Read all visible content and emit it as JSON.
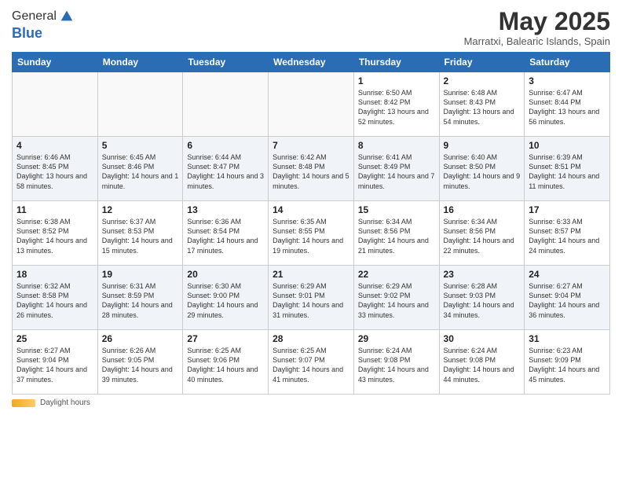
{
  "header": {
    "logo_line1": "General",
    "logo_line2": "Blue",
    "month_title": "May 2025",
    "location": "Marratxi, Balearic Islands, Spain"
  },
  "days_of_week": [
    "Sunday",
    "Monday",
    "Tuesday",
    "Wednesday",
    "Thursday",
    "Friday",
    "Saturday"
  ],
  "weeks": [
    [
      {
        "day": "",
        "info": ""
      },
      {
        "day": "",
        "info": ""
      },
      {
        "day": "",
        "info": ""
      },
      {
        "day": "",
        "info": ""
      },
      {
        "day": "1",
        "info": "Sunrise: 6:50 AM\nSunset: 8:42 PM\nDaylight: 13 hours\nand 52 minutes."
      },
      {
        "day": "2",
        "info": "Sunrise: 6:48 AM\nSunset: 8:43 PM\nDaylight: 13 hours\nand 54 minutes."
      },
      {
        "day": "3",
        "info": "Sunrise: 6:47 AM\nSunset: 8:44 PM\nDaylight: 13 hours\nand 56 minutes."
      }
    ],
    [
      {
        "day": "4",
        "info": "Sunrise: 6:46 AM\nSunset: 8:45 PM\nDaylight: 13 hours\nand 58 minutes."
      },
      {
        "day": "5",
        "info": "Sunrise: 6:45 AM\nSunset: 8:46 PM\nDaylight: 14 hours\nand 1 minute."
      },
      {
        "day": "6",
        "info": "Sunrise: 6:44 AM\nSunset: 8:47 PM\nDaylight: 14 hours\nand 3 minutes."
      },
      {
        "day": "7",
        "info": "Sunrise: 6:42 AM\nSunset: 8:48 PM\nDaylight: 14 hours\nand 5 minutes."
      },
      {
        "day": "8",
        "info": "Sunrise: 6:41 AM\nSunset: 8:49 PM\nDaylight: 14 hours\nand 7 minutes."
      },
      {
        "day": "9",
        "info": "Sunrise: 6:40 AM\nSunset: 8:50 PM\nDaylight: 14 hours\nand 9 minutes."
      },
      {
        "day": "10",
        "info": "Sunrise: 6:39 AM\nSunset: 8:51 PM\nDaylight: 14 hours\nand 11 minutes."
      }
    ],
    [
      {
        "day": "11",
        "info": "Sunrise: 6:38 AM\nSunset: 8:52 PM\nDaylight: 14 hours\nand 13 minutes."
      },
      {
        "day": "12",
        "info": "Sunrise: 6:37 AM\nSunset: 8:53 PM\nDaylight: 14 hours\nand 15 minutes."
      },
      {
        "day": "13",
        "info": "Sunrise: 6:36 AM\nSunset: 8:54 PM\nDaylight: 14 hours\nand 17 minutes."
      },
      {
        "day": "14",
        "info": "Sunrise: 6:35 AM\nSunset: 8:55 PM\nDaylight: 14 hours\nand 19 minutes."
      },
      {
        "day": "15",
        "info": "Sunrise: 6:34 AM\nSunset: 8:56 PM\nDaylight: 14 hours\nand 21 minutes."
      },
      {
        "day": "16",
        "info": "Sunrise: 6:34 AM\nSunset: 8:56 PM\nDaylight: 14 hours\nand 22 minutes."
      },
      {
        "day": "17",
        "info": "Sunrise: 6:33 AM\nSunset: 8:57 PM\nDaylight: 14 hours\nand 24 minutes."
      }
    ],
    [
      {
        "day": "18",
        "info": "Sunrise: 6:32 AM\nSunset: 8:58 PM\nDaylight: 14 hours\nand 26 minutes."
      },
      {
        "day": "19",
        "info": "Sunrise: 6:31 AM\nSunset: 8:59 PM\nDaylight: 14 hours\nand 28 minutes."
      },
      {
        "day": "20",
        "info": "Sunrise: 6:30 AM\nSunset: 9:00 PM\nDaylight: 14 hours\nand 29 minutes."
      },
      {
        "day": "21",
        "info": "Sunrise: 6:29 AM\nSunset: 9:01 PM\nDaylight: 14 hours\nand 31 minutes."
      },
      {
        "day": "22",
        "info": "Sunrise: 6:29 AM\nSunset: 9:02 PM\nDaylight: 14 hours\nand 33 minutes."
      },
      {
        "day": "23",
        "info": "Sunrise: 6:28 AM\nSunset: 9:03 PM\nDaylight: 14 hours\nand 34 minutes."
      },
      {
        "day": "24",
        "info": "Sunrise: 6:27 AM\nSunset: 9:04 PM\nDaylight: 14 hours\nand 36 minutes."
      }
    ],
    [
      {
        "day": "25",
        "info": "Sunrise: 6:27 AM\nSunset: 9:04 PM\nDaylight: 14 hours\nand 37 minutes."
      },
      {
        "day": "26",
        "info": "Sunrise: 6:26 AM\nSunset: 9:05 PM\nDaylight: 14 hours\nand 39 minutes."
      },
      {
        "day": "27",
        "info": "Sunrise: 6:25 AM\nSunset: 9:06 PM\nDaylight: 14 hours\nand 40 minutes."
      },
      {
        "day": "28",
        "info": "Sunrise: 6:25 AM\nSunset: 9:07 PM\nDaylight: 14 hours\nand 41 minutes."
      },
      {
        "day": "29",
        "info": "Sunrise: 6:24 AM\nSunset: 9:08 PM\nDaylight: 14 hours\nand 43 minutes."
      },
      {
        "day": "30",
        "info": "Sunrise: 6:24 AM\nSunset: 9:08 PM\nDaylight: 14 hours\nand 44 minutes."
      },
      {
        "day": "31",
        "info": "Sunrise: 6:23 AM\nSunset: 9:09 PM\nDaylight: 14 hours\nand 45 minutes."
      }
    ]
  ],
  "footer": {
    "daylight_label": "Daylight hours"
  }
}
